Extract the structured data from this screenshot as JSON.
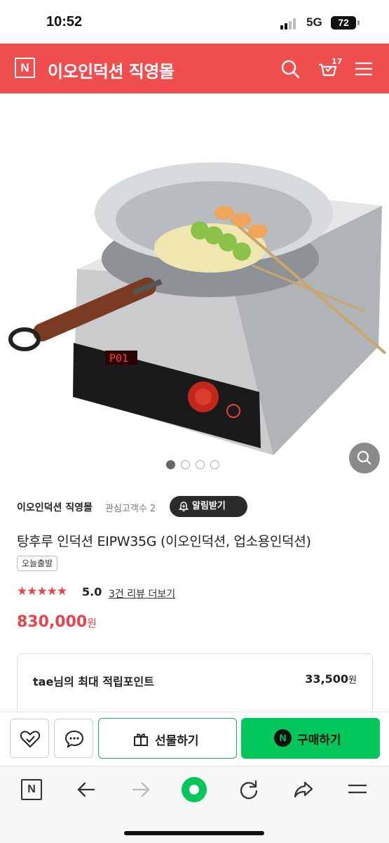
{
  "status_bar": {
    "time": "10:52",
    "network": "5G",
    "battery": "72"
  },
  "header": {
    "logo_letter": "N",
    "store_name": "이오인덕션 직영몰",
    "cart_count": "17",
    "icons": [
      "search-icon",
      "cart-icon",
      "menu-icon"
    ],
    "background_color": "#f04e4e"
  },
  "gallery": {
    "image_description_icon": "product-photo-induction-wok",
    "total_slides": 4,
    "active_slide": 1
  },
  "seller": {
    "name": "이오인덕션 직영몰",
    "watchers_label": "관심고객수 2",
    "alarm_button": "알림받기"
  },
  "product": {
    "title": "탕후루 인덕션 EIPW35G (이오인덕션, 업소용인덕션)",
    "shipping_badge": "오늘출발",
    "stars": "★★★★★",
    "rating": "5.0",
    "review_link": "3건 리뷰 더보기",
    "price": "830,000",
    "price_unit": "원",
    "price_color": "#e8434a"
  },
  "points": {
    "label": "tae님의 최대 적립포인트",
    "value": "33,500",
    "unit": "원"
  },
  "actions": {
    "gift_label": "선물하기",
    "buy_label": "구매하기",
    "pay_letter": "N",
    "accent_color": "#03c75a"
  },
  "browser": {
    "logo_letter": "N",
    "icons": [
      "naver-home-icon",
      "back-arrow-icon",
      "forward-arrow-icon",
      "green-dot-icon",
      "refresh-icon",
      "share-icon",
      "menu-icon"
    ]
  }
}
